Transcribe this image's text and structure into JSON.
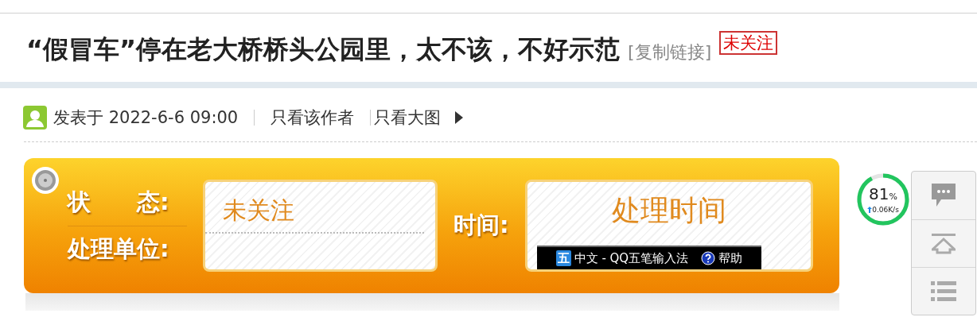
{
  "title": "“假冒车”停在老大桥桥头公园里，太不该，不好示范",
  "copy_link": "[复制链接]",
  "follow_badge": "未关注",
  "meta": {
    "posted": "发表于 2022-6-6 09:00",
    "author_only": "只看该作者",
    "large_images": "只看大图"
  },
  "panel": {
    "status_label": "状　　态:",
    "status_value": "未关注",
    "unit_label": "处理单位:",
    "time_label": "时间:",
    "time_value": "处理时间"
  },
  "ime_bar": {
    "badge": "五",
    "name": "中文 - QQ五笔输入法",
    "help": "帮助"
  },
  "monitor": {
    "percent": "81",
    "unit": "%",
    "speed": "0.06K/s"
  },
  "side_tools": [
    {
      "kind": "comment"
    },
    {
      "kind": "top"
    },
    {
      "kind": "list"
    }
  ]
}
